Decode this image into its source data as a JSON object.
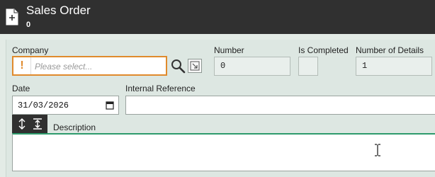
{
  "header": {
    "title": "Sales Order",
    "subtitle": "0",
    "icon": "new-document-icon"
  },
  "form": {
    "company": {
      "label": "Company",
      "placeholder": "Please select...",
      "value": "",
      "warning_color": "#e08a2c"
    },
    "number": {
      "label": "Number",
      "value": "0"
    },
    "is_completed": {
      "label": "Is Completed",
      "checked": false
    },
    "number_of_details": {
      "label": "Number of Details",
      "value": "1"
    },
    "date": {
      "label": "Date",
      "value": "31/03/2026"
    },
    "internal_reference": {
      "label": "Internal Reference",
      "value": ""
    },
    "description": {
      "label": "Description",
      "value": ""
    }
  },
  "colors": {
    "header_bg": "#303030",
    "form_bg": "#dde7e2",
    "accent": "#2e9b6c",
    "warning": "#e08a2c"
  }
}
